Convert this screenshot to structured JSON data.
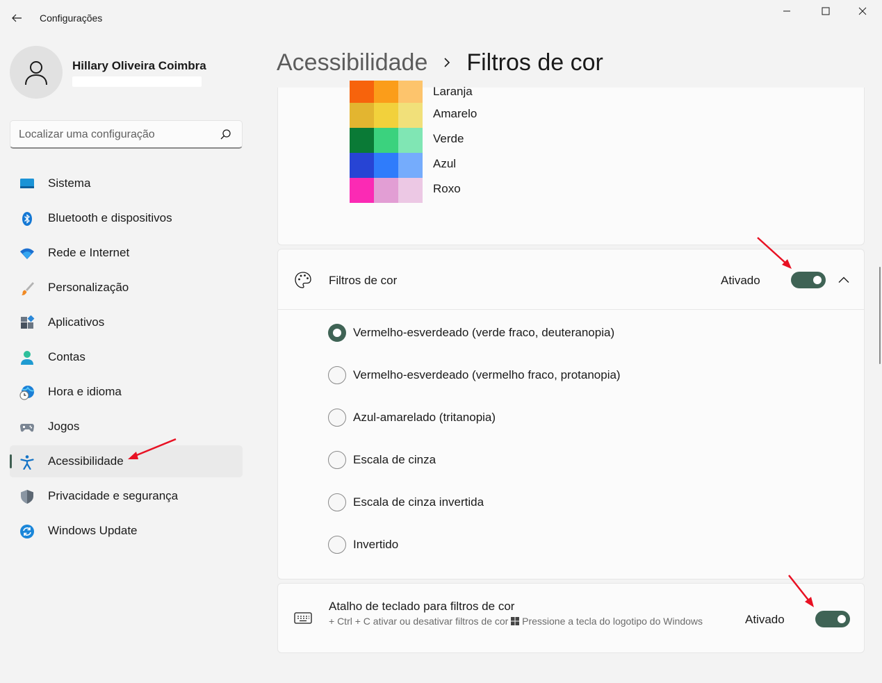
{
  "window": {
    "title": "Configurações",
    "back_icon": "arrow-left-icon",
    "controls": [
      "minimize-icon",
      "maximize-icon",
      "close-icon"
    ]
  },
  "user": {
    "name": "Hillary Oliveira Coimbra",
    "avatar_icon": "person-icon"
  },
  "search": {
    "placeholder": "Localizar uma configuração",
    "value": "",
    "icon": "search-icon"
  },
  "sidebar": {
    "items": [
      {
        "label": "Sistema",
        "icon": "monitor-icon"
      },
      {
        "label": "Bluetooth e dispositivos",
        "icon": "bluetooth-icon"
      },
      {
        "label": "Rede e Internet",
        "icon": "wifi-icon"
      },
      {
        "label": "Personalização",
        "icon": "brush-icon"
      },
      {
        "label": "Aplicativos",
        "icon": "apps-icon"
      },
      {
        "label": "Contas",
        "icon": "account-icon"
      },
      {
        "label": "Hora e idioma",
        "icon": "clock-globe-icon"
      },
      {
        "label": "Jogos",
        "icon": "gamepad-icon"
      },
      {
        "label": "Acessibilidade",
        "icon": "accessibility-icon",
        "active": true
      },
      {
        "label": "Privacidade e segurança",
        "icon": "shield-icon"
      },
      {
        "label": "Windows Update",
        "icon": "update-icon"
      }
    ]
  },
  "breadcrumb": {
    "parent": "Acessibilidade",
    "current": "Filtros de cor"
  },
  "palette": {
    "rows": [
      {
        "label": "Laranja",
        "colors": [
          "#f7630c",
          "#fb9d1a",
          "#fdc46c"
        ]
      },
      {
        "label": "Amarelo",
        "colors": [
          "#e3b530",
          "#f2d13c",
          "#f1e07a"
        ]
      },
      {
        "label": "Verde",
        "colors": [
          "#0a7a36",
          "#3bd27e",
          "#80e6b4"
        ]
      },
      {
        "label": "Azul",
        "colors": [
          "#2744d4",
          "#2f7cfb",
          "#75acfc"
        ]
      },
      {
        "label": "Roxo",
        "colors": [
          "#fb2ab4",
          "#e29ed4",
          "#ecc8e4"
        ]
      }
    ]
  },
  "color_filters": {
    "title": "Filtros de cor",
    "icon": "palette-icon",
    "state": "Ativado",
    "enabled": true,
    "expand_icon": "chevron-up-icon",
    "options": [
      {
        "label": "Vermelho-esverdeado (verde fraco, deuteranopia)",
        "selected": true
      },
      {
        "label": "Vermelho-esverdeado (vermelho fraco, protanopia)",
        "selected": false
      },
      {
        "label": "Azul-amarelado (tritanopia)",
        "selected": false
      },
      {
        "label": "Escala de cinza",
        "selected": false
      },
      {
        "label": "Escala de cinza invertida",
        "selected": false
      },
      {
        "label": "Invertido",
        "selected": false
      }
    ]
  },
  "shortcut": {
    "title": "Atalho de teclado para filtros de cor",
    "icon": "keyboard-icon",
    "desc_before": "+ Ctrl + C ativar ou desativar filtros de cor",
    "desc_after": "Pressione a tecla do logotipo do Windows",
    "windows_key_icon": "windows-logo-icon",
    "state": "Ativado",
    "enabled": true
  },
  "colors": {
    "accent": "#3f6355",
    "annotation_arrow": "#e81123"
  }
}
